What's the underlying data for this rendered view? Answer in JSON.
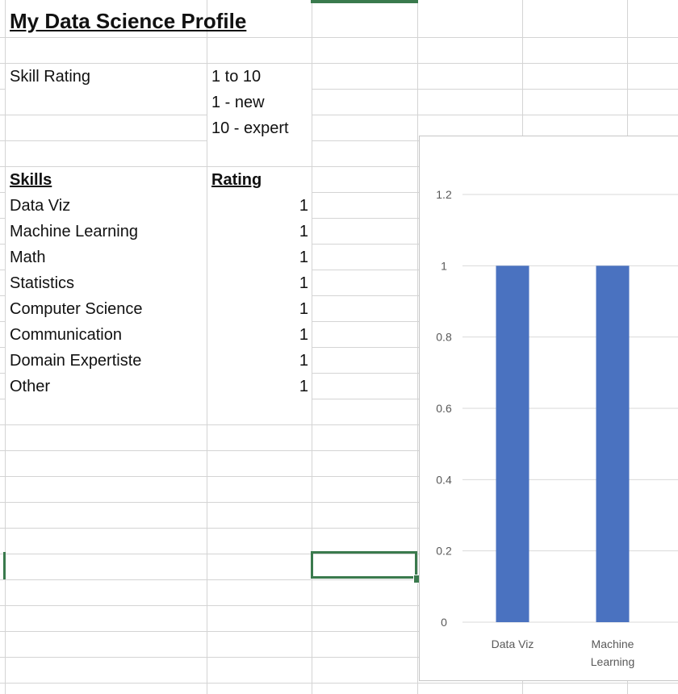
{
  "sheet": {
    "title": "My Data Science Profile",
    "skill_rating": {
      "label": "Skill Rating",
      "lines": [
        "1 to  10",
        "1 - new",
        "10 - expert"
      ]
    },
    "table": {
      "headers": {
        "skills": "Skills",
        "rating": "Rating"
      },
      "rows": [
        {
          "skill": "Data Viz",
          "rating": "1"
        },
        {
          "skill": "Machine Learning",
          "rating": "1"
        },
        {
          "skill": "Math",
          "rating": "1"
        },
        {
          "skill": "Statistics",
          "rating": "1"
        },
        {
          "skill": "Computer Science",
          "rating": "1"
        },
        {
          "skill": "Communication",
          "rating": "1"
        },
        {
          "skill": "Domain Expertiste",
          "rating": "1"
        },
        {
          "skill": "Other",
          "rating": "1"
        }
      ]
    }
  },
  "colors": {
    "bar": "#4a72c0",
    "selection": "#3a7a4d",
    "gridline": "#d4d4d4",
    "chart_gridline": "#d9d9d9",
    "axis_text": "#595959"
  },
  "chart_data": {
    "type": "bar",
    "categories": [
      "Data Viz",
      "Machine Learning"
    ],
    "category_lines": [
      [
        "Data Viz"
      ],
      [
        "Machine",
        "Learning"
      ]
    ],
    "values": [
      1,
      1
    ],
    "ylim": [
      0,
      1.2
    ],
    "yticks": [
      0,
      0.2,
      0.4,
      0.6,
      0.8,
      1,
      1.2
    ],
    "ytick_labels": [
      "0",
      "0.2",
      "0.4",
      "0.6",
      "0.8",
      "1",
      "1.2"
    ],
    "title": "",
    "xlabel": "",
    "ylabel": "",
    "grid": true,
    "legend": "none"
  }
}
